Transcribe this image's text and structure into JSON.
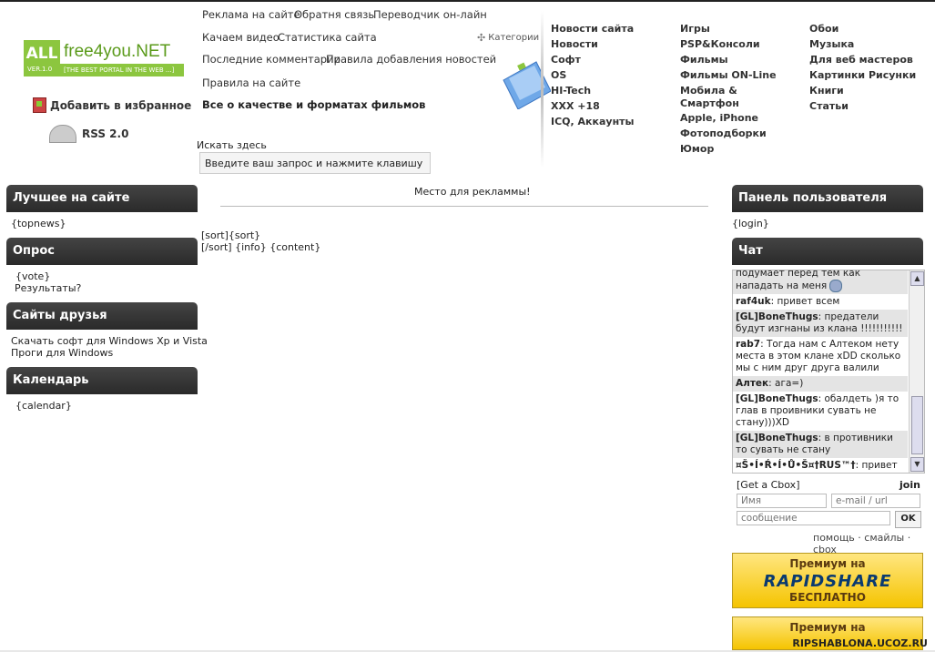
{
  "logo": {
    "all": "ALL",
    "name": "free4you.NET",
    "ver": "VER.1.0",
    "tagline": "[THE BEST PORTAL IN THE WEB ...]"
  },
  "favorites": "Добавить в избранное",
  "rss": "RSS 2.0",
  "topnav": {
    "row1": [
      "Реклама на сайте",
      "Обратня связь",
      "Переводчик он-лайн"
    ],
    "row2": [
      "Качаем видео",
      "Статистика сайта"
    ],
    "row3": [
      "Последние комментарии",
      "Правила добавления новостей"
    ],
    "row4": [
      "Правила на сайте"
    ],
    "row5": "Все о качестве и форматах фильмов"
  },
  "categories_label": "Категории",
  "search": {
    "label": "Искать здесь",
    "value": "Введите ваш запрос и нажмите клавишу ENTER"
  },
  "categories": {
    "col1": [
      "Новости сайта",
      "Новости",
      "Софт",
      "OS",
      "HI-Tech",
      "XXX +18",
      "ICQ, Аккаунты"
    ],
    "col2": [
      "Игры",
      "PSP&Консоли",
      "Фильмы",
      "Фильмы ON-Line",
      "Мобила & Смартфон",
      "Apple, iPhone",
      "Фотоподборки",
      "Юмор"
    ],
    "col3": [
      "Обои",
      "Музыка",
      "Для веб мастеров",
      "Картинки Рисунки",
      "Книги",
      "Статьи"
    ]
  },
  "left": {
    "best": {
      "title": "Лучшее на сайте",
      "body": "{topnews}"
    },
    "poll": {
      "title": "Опрос",
      "vote": "{vote}",
      "results": "Результаты?"
    },
    "friends": {
      "title": "Сайты друзья",
      "links": [
        "Скачать софт для Windows Xp и Vista",
        "Проги для Windows"
      ]
    },
    "calendar": {
      "title": "Календарь",
      "body": "{calendar}"
    }
  },
  "center": {
    "ad": "Место для рекламмы!",
    "line1": "[sort]{sort}",
    "line2": "[/sort] {info} {content}"
  },
  "right": {
    "panel": {
      "title": "Панель пользователя",
      "body": "{login}"
    },
    "chat": {
      "title": "Чат",
      "messages": [
        {
          "user": "",
          "text": "подумает перед тем как нападать на меня",
          "alt": true
        },
        {
          "user": "raf4uk",
          "text": ": привет всем",
          "alt": false
        },
        {
          "user": "[GL]BoneThugs",
          "text": ": предатели будут изгнаны из клана !!!!!!!!!!!",
          "alt": true
        },
        {
          "user": "rab7",
          "text": ": Тогда нам с Алтеком нету места в этом клане xDD сколько мы с ним друг друга валили",
          "alt": false
        },
        {
          "user": "Алтек",
          "text": ": ага=)",
          "alt": true
        },
        {
          "user": "[GL]BoneThugs",
          "text": ": обалдеть )я то глав в проивники сувать не стану)))XD",
          "alt": false
        },
        {
          "user": "[GL]BoneThugs",
          "text": ": в противники то сувать не стану",
          "alt": true
        },
        {
          "user": "¤Š•Í•Ŕ•Í•Ů•Š¤†RUS™†",
          "text": ": привет",
          "alt": false
        }
      ],
      "get": "[Get a Cbox]",
      "join": "join",
      "name_ph": "Имя",
      "email_ph": "e-mail / url",
      "msg_ph": "сообщение",
      "ok": "OK",
      "footer": "помощь · смайлы · cbox"
    },
    "banner1": {
      "t1": "Премиум на",
      "t2": "RAPIDSHARE",
      "t3": "БЕСПЛАТНО"
    },
    "banner2": {
      "t1": "Премиум на"
    }
  },
  "watermark": "RIPSHABLONA.UCOZ.RU"
}
